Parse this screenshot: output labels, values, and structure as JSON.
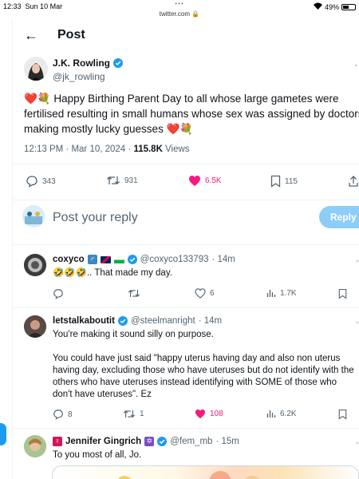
{
  "status_bar": {
    "time": "12:33",
    "date": "Sun 10 Mar",
    "url": "twitter.com",
    "dots": "•••",
    "battery": "49%"
  },
  "header": {
    "back": "←",
    "title": "Post"
  },
  "tweet": {
    "author": "J.K. Rowling",
    "handle": "@jk_rowling",
    "text_line1": "❤️💐 Happy Birthing Parent Day to all whose large gametes were",
    "text_line2": "fertilised resulting in small humans whose sex was assigned by doctors",
    "text_line3": "making mostly lucky guesses ❤️💐",
    "time": "12:13 PM · Mar 10, 2024 · ",
    "views_count": "115.8K",
    "views_label": " Views",
    "replies": "343",
    "reposts": "931",
    "likes": "6.5K",
    "bookmarks": "115"
  },
  "reply_box": {
    "placeholder": "Post your reply",
    "button": "Reply"
  },
  "replies": [
    {
      "name": "coxyco",
      "handle": "@coxyco133793",
      "time": "· 14m",
      "text": "🤣🤣🤣.. That made my day.",
      "replies": "",
      "reposts": "",
      "likes": "6",
      "views": "1.7K"
    },
    {
      "name": "letstalkaboutit",
      "handle": "@steelmanright",
      "time": "· 14m",
      "text1": "You're making it sound silly on purpose.",
      "text2": "You could have just said \"happy uterus having day and also non uterus",
      "text3": "having day, excluding those who have uteruses but do not identify with the",
      "text4": "others who have uteruses instead identifying with SOME of those who",
      "text5": "don't have uteruses\". Ez",
      "replies": "8",
      "reposts": "1",
      "likes": "108",
      "views": "6.2K"
    },
    {
      "name": "Jennifer Gingrich",
      "handle": "@fem_mb",
      "time": "· 15m",
      "text": "To you most of all, Jo."
    }
  ],
  "colors": {
    "accent": "#1d9bf0",
    "like": "#f91880",
    "muted": "#536471"
  }
}
